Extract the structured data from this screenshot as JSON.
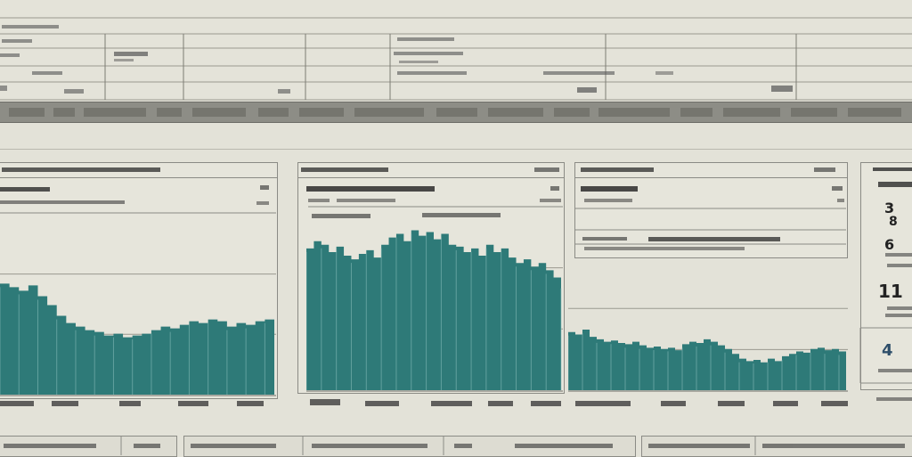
{
  "header_table": {
    "cells": []
  },
  "charts": [],
  "side_panel": {
    "values": [
      "3",
      "8",
      "6",
      "11",
      "4"
    ]
  },
  "footer": {
    "items": []
  },
  "colors": {
    "fill": "#2e7a78",
    "fill_light": "#3e8c8a",
    "background": "#e3e2d8",
    "line": "#8b8b85"
  },
  "chart_data": [
    {
      "type": "area",
      "title": "",
      "x": [
        0,
        1,
        2,
        3,
        4,
        5,
        6,
        7,
        8,
        9,
        10,
        11,
        12,
        13,
        14,
        15,
        16,
        17,
        18,
        19,
        20,
        21,
        22,
        23,
        24,
        25,
        26,
        27,
        28,
        29
      ],
      "series": [
        {
          "values": [
            62,
            60,
            58,
            61,
            55,
            50,
            44,
            40,
            38,
            36,
            35,
            33,
            34,
            32,
            33,
            34,
            36,
            38,
            37,
            39,
            41,
            40,
            42,
            41,
            38,
            40,
            39,
            41,
            42,
            40
          ]
        }
      ],
      "ylim": [
        0,
        100
      ],
      "grid": true
    },
    {
      "type": "area",
      "title": "",
      "x": [
        0,
        1,
        2,
        3,
        4,
        5,
        6,
        7,
        8,
        9,
        10,
        11,
        12,
        13,
        14,
        15,
        16,
        17,
        18,
        19,
        20,
        21,
        22,
        23,
        24,
        25,
        26,
        27,
        28,
        29,
        30,
        31,
        32,
        33,
        34
      ],
      "series": [
        {
          "values": [
            78,
            82,
            80,
            76,
            79,
            74,
            72,
            75,
            77,
            73,
            80,
            84,
            86,
            82,
            88,
            85,
            87,
            83,
            86,
            80,
            79,
            76,
            78,
            74,
            80,
            76,
            78,
            73,
            70,
            72,
            68,
            70,
            66,
            62,
            58
          ]
        }
      ],
      "ylim": [
        0,
        100
      ],
      "grid": true
    },
    {
      "type": "area",
      "title": "",
      "x": [
        0,
        1,
        2,
        3,
        4,
        5,
        6,
        7,
        8,
        9,
        10,
        11,
        12,
        13,
        14,
        15,
        16,
        17,
        18,
        19,
        20,
        21,
        22,
        23,
        24,
        25,
        26,
        27,
        28,
        29,
        30,
        31,
        32,
        33,
        34,
        35,
        36,
        37,
        38,
        39
      ],
      "series": [
        {
          "values": [
            48,
            46,
            50,
            44,
            42,
            40,
            41,
            39,
            38,
            40,
            37,
            35,
            36,
            34,
            35,
            33,
            38,
            40,
            39,
            42,
            40,
            37,
            34,
            30,
            26,
            24,
            25,
            23,
            26,
            24,
            28,
            30,
            32,
            31,
            34,
            35,
            33,
            34,
            32,
            30
          ]
        }
      ],
      "ylim": [
        0,
        100
      ],
      "grid": true
    }
  ]
}
